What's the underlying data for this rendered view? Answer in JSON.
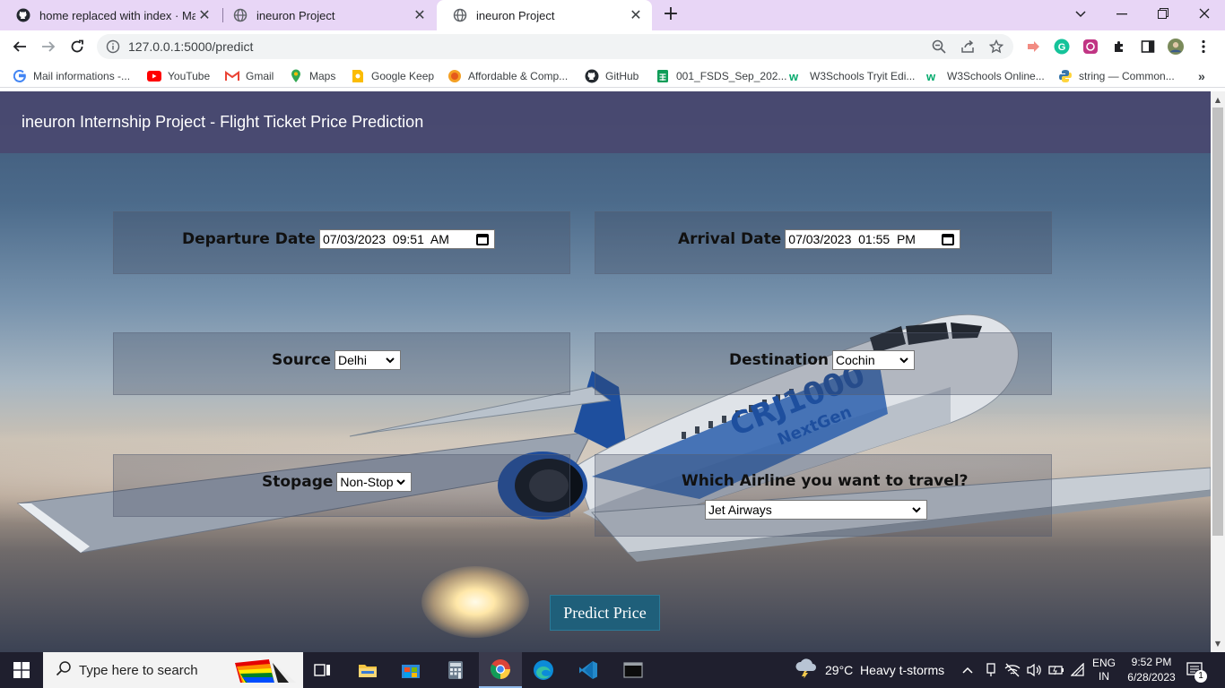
{
  "browser": {
    "tabs": [
      {
        "label": "home replaced with index · Maur",
        "icon": "github-icon",
        "active": false
      },
      {
        "label": "ineuron Project",
        "icon": "globe-icon",
        "active": false
      },
      {
        "label": "ineuron Project",
        "icon": "globe-icon",
        "active": true
      }
    ],
    "url": "127.0.0.1:5000/predict",
    "bookmarks": [
      {
        "label": "Mail informations -...",
        "icon": "google-icon"
      },
      {
        "label": "YouTube",
        "icon": "youtube-icon"
      },
      {
        "label": "Gmail",
        "icon": "gmail-icon"
      },
      {
        "label": "Maps",
        "icon": "maps-icon"
      },
      {
        "label": "Google Keep",
        "icon": "keep-icon"
      },
      {
        "label": "Affordable & Comp...",
        "icon": "orange-circle-icon"
      },
      {
        "label": "GitHub",
        "icon": "github-icon"
      },
      {
        "label": "001_FSDS_Sep_202...",
        "icon": "sheets-icon"
      },
      {
        "label": "W3Schools Tryit Edi...",
        "icon": "w3schools-icon"
      },
      {
        "label": "W3Schools Online...",
        "icon": "w3schools-icon"
      },
      {
        "label": "string — Common...",
        "icon": "python-icon"
      }
    ]
  },
  "page": {
    "title": "ineuron Internship Project - Flight Ticket Price Prediction",
    "departure": {
      "label": "Departure Date",
      "value": "07/03/2023  09:51  AM"
    },
    "arrival": {
      "label": "Arrival Date",
      "value": "07/03/2023  01:55  PM"
    },
    "source": {
      "label": "Source",
      "value": "Delhi"
    },
    "destination": {
      "label": "Destination",
      "value": "Cochin"
    },
    "stopage": {
      "label": "Stopage",
      "value": "Non-Stop"
    },
    "airline": {
      "label": "Which Airline you want to travel?",
      "value": "Jet Airways"
    },
    "predict_button": "Predict Price",
    "plane_livery": {
      "brand": "CRJ1000",
      "sub": "NextGen"
    }
  },
  "taskbar": {
    "search_placeholder": "Type here to search",
    "weather": "29°C  Heavy t-storms",
    "lang_top": "ENG",
    "lang_bottom": "IN",
    "time": "9:52 PM",
    "date": "6/28/2023",
    "notification_count": "1"
  },
  "colors": {
    "tabbar": "#e8d6f6",
    "header": "#4b466e",
    "predict_button": "#1f5f7a",
    "taskbar": "#1f1f2e"
  }
}
